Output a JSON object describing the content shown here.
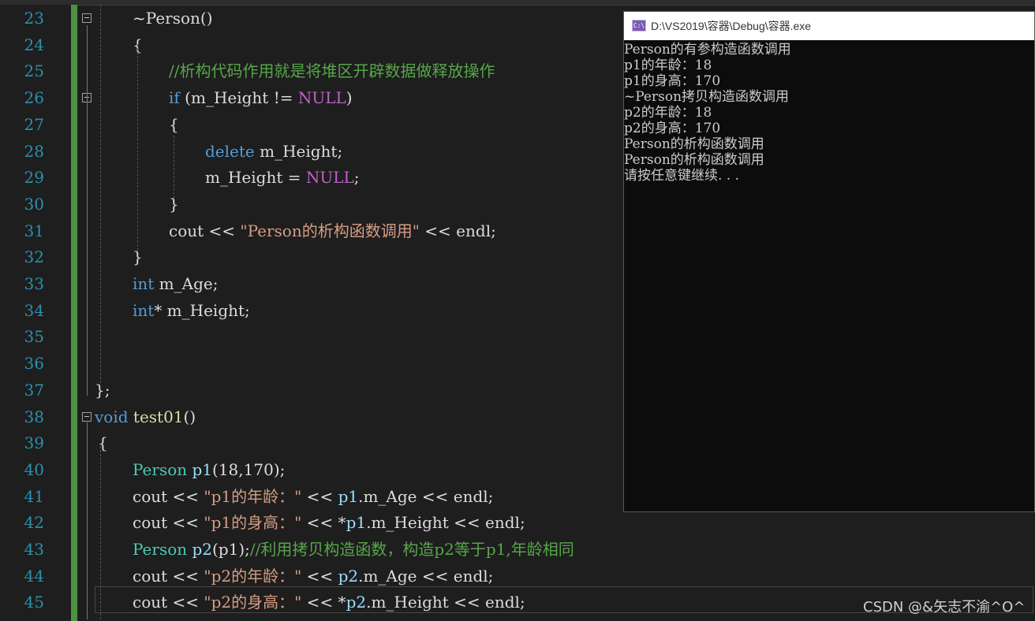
{
  "editor": {
    "lines": [
      {
        "num": "23",
        "segments": [
          {
            "t": "~Person()",
            "c": "plain"
          }
        ]
      },
      {
        "num": "24",
        "segments": [
          {
            "t": "{",
            "c": "plain"
          }
        ]
      },
      {
        "num": "25",
        "segments": [
          {
            "t": "//析构代码作用就是将堆区开辟数据做释放操作",
            "c": "cmt"
          }
        ]
      },
      {
        "num": "26",
        "segments": [
          {
            "t": "if",
            "c": "kw"
          },
          {
            "t": " (m_Height != ",
            "c": "plain"
          },
          {
            "t": "NULL",
            "c": "macro"
          },
          {
            "t": ")",
            "c": "plain"
          }
        ]
      },
      {
        "num": "27",
        "segments": [
          {
            "t": "{",
            "c": "plain"
          }
        ]
      },
      {
        "num": "28",
        "segments": [
          {
            "t": "delete",
            "c": "kw"
          },
          {
            "t": " m_Height;",
            "c": "plain"
          }
        ]
      },
      {
        "num": "29",
        "segments": [
          {
            "t": "m_Height = ",
            "c": "plain"
          },
          {
            "t": "NULL",
            "c": "macro"
          },
          {
            "t": ";",
            "c": "plain"
          }
        ]
      },
      {
        "num": "30",
        "segments": [
          {
            "t": "}",
            "c": "plain"
          }
        ]
      },
      {
        "num": "31",
        "segments": [
          {
            "t": "cout << ",
            "c": "plain"
          },
          {
            "t": "\"Person的析构函数调用\"",
            "c": "str"
          },
          {
            "t": " << endl;",
            "c": "plain"
          }
        ]
      },
      {
        "num": "32",
        "segments": [
          {
            "t": "}",
            "c": "plain"
          }
        ]
      },
      {
        "num": "33",
        "segments": [
          {
            "t": "int",
            "c": "kw"
          },
          {
            "t": " m_Age;",
            "c": "plain"
          }
        ]
      },
      {
        "num": "34",
        "segments": [
          {
            "t": "int",
            "c": "kw"
          },
          {
            "t": "* m_Height;",
            "c": "plain"
          }
        ]
      },
      {
        "num": "35",
        "segments": []
      },
      {
        "num": "36",
        "segments": []
      },
      {
        "num": "37",
        "segments": [
          {
            "t": "};",
            "c": "plain"
          }
        ]
      },
      {
        "num": "38",
        "segments": [
          {
            "t": "void",
            "c": "kw"
          },
          {
            "t": " ",
            "c": "plain"
          },
          {
            "t": "test01",
            "c": "fn"
          },
          {
            "t": "()",
            "c": "plain"
          }
        ]
      },
      {
        "num": "39",
        "segments": [
          {
            "t": "{",
            "c": "plain"
          }
        ]
      },
      {
        "num": "40",
        "segments": [
          {
            "t": "Person",
            "c": "type"
          },
          {
            "t": " ",
            "c": "plain"
          },
          {
            "t": "p1",
            "c": "var"
          },
          {
            "t": "(18,170);",
            "c": "plain"
          }
        ]
      },
      {
        "num": "41",
        "segments": [
          {
            "t": "cout << ",
            "c": "plain"
          },
          {
            "t": "\"p1的年龄：\"",
            "c": "str"
          },
          {
            "t": " << ",
            "c": "plain"
          },
          {
            "t": "p1",
            "c": "var"
          },
          {
            "t": ".m_Age << endl;",
            "c": "plain"
          }
        ]
      },
      {
        "num": "42",
        "segments": [
          {
            "t": "cout << ",
            "c": "plain"
          },
          {
            "t": "\"p1的身高：\"",
            "c": "str"
          },
          {
            "t": " << *",
            "c": "plain"
          },
          {
            "t": "p1",
            "c": "var"
          },
          {
            "t": ".m_Height << endl;",
            "c": "plain"
          }
        ]
      },
      {
        "num": "43",
        "segments": [
          {
            "t": "Person",
            "c": "type"
          },
          {
            "t": " ",
            "c": "plain"
          },
          {
            "t": "p2",
            "c": "var"
          },
          {
            "t": "(p1);",
            "c": "plain"
          },
          {
            "t": "//利用拷贝构造函数，构造p2等于p1,年龄相同",
            "c": "cmt"
          }
        ]
      },
      {
        "num": "44",
        "segments": [
          {
            "t": "cout << ",
            "c": "plain"
          },
          {
            "t": "\"p2的年龄：\"",
            "c": "str"
          },
          {
            "t": " << ",
            "c": "plain"
          },
          {
            "t": "p2",
            "c": "var"
          },
          {
            "t": ".m_Age << endl;",
            "c": "plain"
          }
        ]
      },
      {
        "num": "45",
        "segments": [
          {
            "t": "cout << ",
            "c": "plain"
          },
          {
            "t": "\"p2的身高：\"",
            "c": "str"
          },
          {
            "t": " << *",
            "c": "plain"
          },
          {
            "t": "p2",
            "c": "var"
          },
          {
            "t": ".m_Height << endl;",
            "c": "plain"
          }
        ]
      }
    ]
  },
  "console": {
    "title": "D:\\VS2019\\容器\\Debug\\容器.exe",
    "icon_label": "C:\\",
    "output": [
      "Person的有参构造函数调用",
      "p1的年龄：18",
      "p1的身高：170",
      "~Person拷贝构造函数调用",
      "p2的年龄：18",
      "p2的身高：170",
      "Person的析构函数调用",
      "Person的析构函数调用",
      "请按任意键继续. . ."
    ]
  },
  "watermark": "CSDN @&矢志不渝^O^"
}
